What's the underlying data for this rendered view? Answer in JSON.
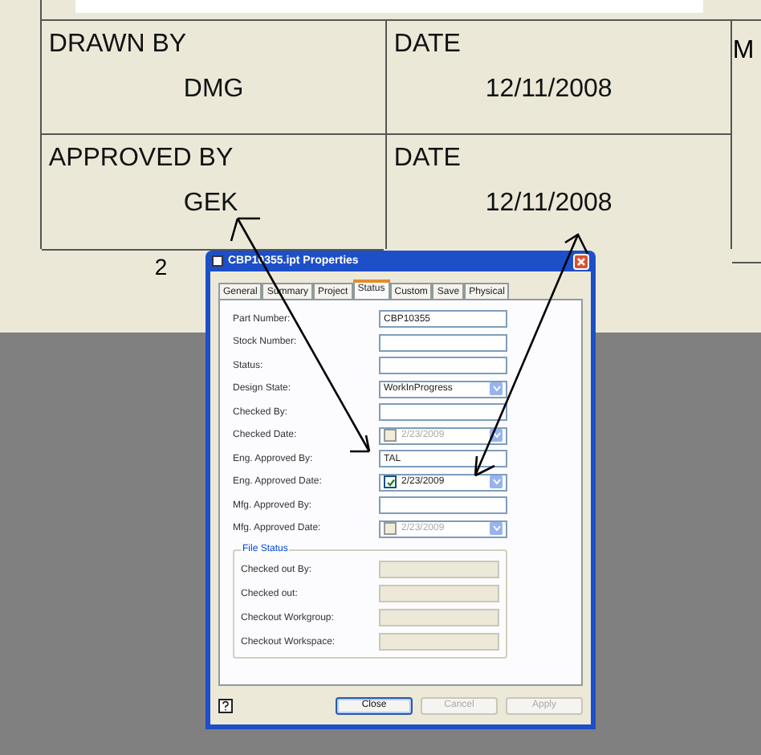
{
  "title_block": {
    "rows": [
      {
        "label": "DRAWN BY",
        "value": "DMG",
        "date_label": "DATE",
        "date_value": "12/11/2008"
      },
      {
        "label": "APPROVED BY",
        "value": "GEK",
        "date_label": "DATE",
        "date_value": "12/11/2008"
      }
    ],
    "right_column": "M",
    "sheet_number": "2"
  },
  "dialog": {
    "title": "CBP10355.ipt Properties",
    "tabs": [
      {
        "label": "General",
        "selected": false
      },
      {
        "label": "Summary",
        "selected": false
      },
      {
        "label": "Project",
        "selected": false
      },
      {
        "label": "Status",
        "selected": true
      },
      {
        "label": "Custom",
        "selected": false
      },
      {
        "label": "Save",
        "selected": false
      },
      {
        "label": "Physical",
        "selected": false
      }
    ],
    "fields": [
      {
        "label": "Part Number:",
        "kind": "text",
        "value": "CBP10355"
      },
      {
        "label": "Stock Number:",
        "kind": "text"
      },
      {
        "label": "Status:",
        "kind": "text"
      },
      {
        "label": "Design State:",
        "kind": "dropdown",
        "value": "WorkInProgress"
      },
      {
        "label": "Checked By:",
        "kind": "text"
      },
      {
        "label": "Checked Date:",
        "kind": "date",
        "checked": false,
        "value": "2/23/2009"
      },
      {
        "label": "Eng. Approved By:",
        "kind": "text",
        "value": "TAL"
      },
      {
        "label": "Eng. Approved Date:",
        "kind": "date",
        "checked": true,
        "value": "2/23/2009"
      },
      {
        "label": "Mfg. Approved By:",
        "kind": "text"
      },
      {
        "label": "Mfg. Approved Date:",
        "kind": "date",
        "checked": false,
        "value": "2/23/2009"
      }
    ],
    "file_status": {
      "title": "File Status",
      "fields": [
        "Checked out By:",
        "Checked out:",
        "Checkout Workgroup:",
        "Checkout Workspace:"
      ]
    },
    "buttons": [
      {
        "label": "Close",
        "disabled": false
      },
      {
        "label": "Cancel",
        "disabled": true
      },
      {
        "label": "Apply",
        "disabled": true
      }
    ]
  }
}
